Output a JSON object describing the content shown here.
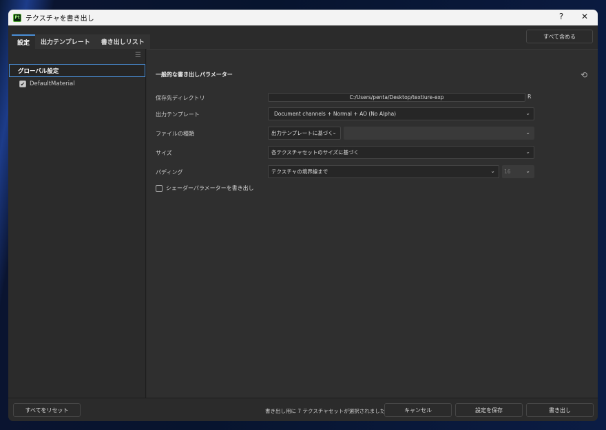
{
  "window": {
    "app_badge": "Pt",
    "title": "テクスチャを書き出し",
    "help": "?",
    "close": "✕"
  },
  "tabs": [
    {
      "label": "設定"
    },
    {
      "label": "出力テンプレート"
    },
    {
      "label": "書き出しリスト"
    }
  ],
  "include_all": "すべて含める",
  "sidebar": {
    "global": "グローバル設定",
    "items": [
      {
        "label": "DefaultMaterial",
        "checked": true
      }
    ]
  },
  "section_title": "一般的な書き出しパラメーター",
  "form": {
    "dir": {
      "label": "保存先ディレクトリ",
      "value": "C:/Users/penta/Desktop/textiure-exp",
      "suffix": "R"
    },
    "template": {
      "label": "出力テンプレート",
      "value": "Document channels + Normal + AO (No Alpha)"
    },
    "filetype": {
      "label": "ファイルの種類",
      "value": "出力テンプレートに基づく",
      "value2": ""
    },
    "size": {
      "label": "サイズ",
      "value": "各テクスチャセットのサイズに基づく"
    },
    "padding": {
      "label": "パディング",
      "value": "テクスチャの境界線まで",
      "value2": "16"
    },
    "shader": {
      "label": "シェーダーパラメーターを書き出し",
      "checked": false
    }
  },
  "footer": {
    "reset": "すべてをリセット",
    "status": "書き出し用に 7 テクスチャセットが選択されました",
    "cancel": "キャンセル",
    "save": "設定を保存",
    "export": "書き出し"
  },
  "colors": {
    "accent": "#4a90d9"
  }
}
